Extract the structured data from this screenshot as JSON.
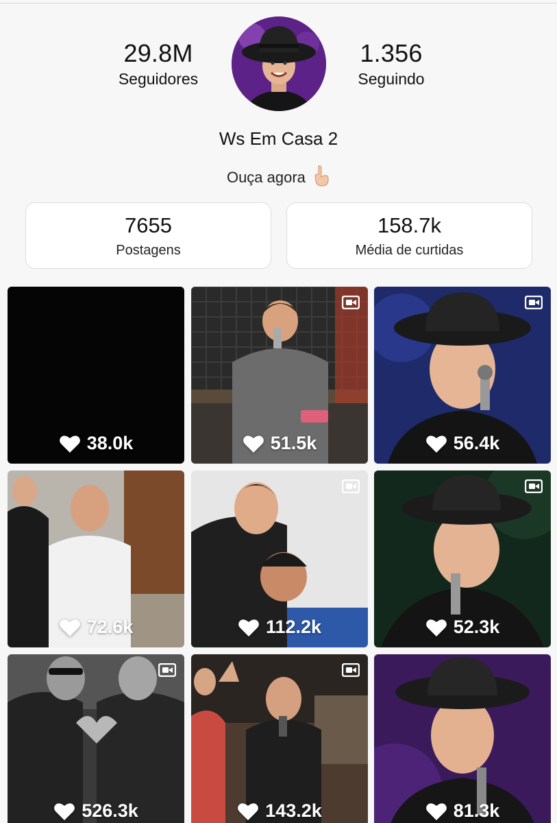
{
  "profile": {
    "followers_count": "29.8M",
    "followers_label": "Seguidores",
    "following_count": "1.356",
    "following_label": "Seguindo",
    "name": "Ws Em Casa 2",
    "bio": "Ouça agora",
    "bio_emoji": "pointing-down-hand"
  },
  "stats": {
    "posts_count": "7655",
    "posts_label": "Postagens",
    "avg_likes": "158.7k",
    "avg_likes_label": "Média de curtidas"
  },
  "posts": [
    {
      "likes": "38.0k",
      "video": false,
      "scene": "black"
    },
    {
      "likes": "51.5k",
      "video": true,
      "scene": "studio"
    },
    {
      "likes": "56.4k",
      "video": true,
      "scene": "singer-hat-blue"
    },
    {
      "likes": "72.6k",
      "video": false,
      "scene": "room"
    },
    {
      "likes": "112.2k",
      "video": true,
      "scene": "friends"
    },
    {
      "likes": "52.3k",
      "video": true,
      "scene": "singer-hat-green"
    },
    {
      "likes": "526.3k",
      "video": true,
      "scene": "bw-heart"
    },
    {
      "likes": "143.2k",
      "video": true,
      "scene": "party"
    },
    {
      "likes": "81.3k",
      "video": false,
      "scene": "singer-hat-purple"
    }
  ]
}
